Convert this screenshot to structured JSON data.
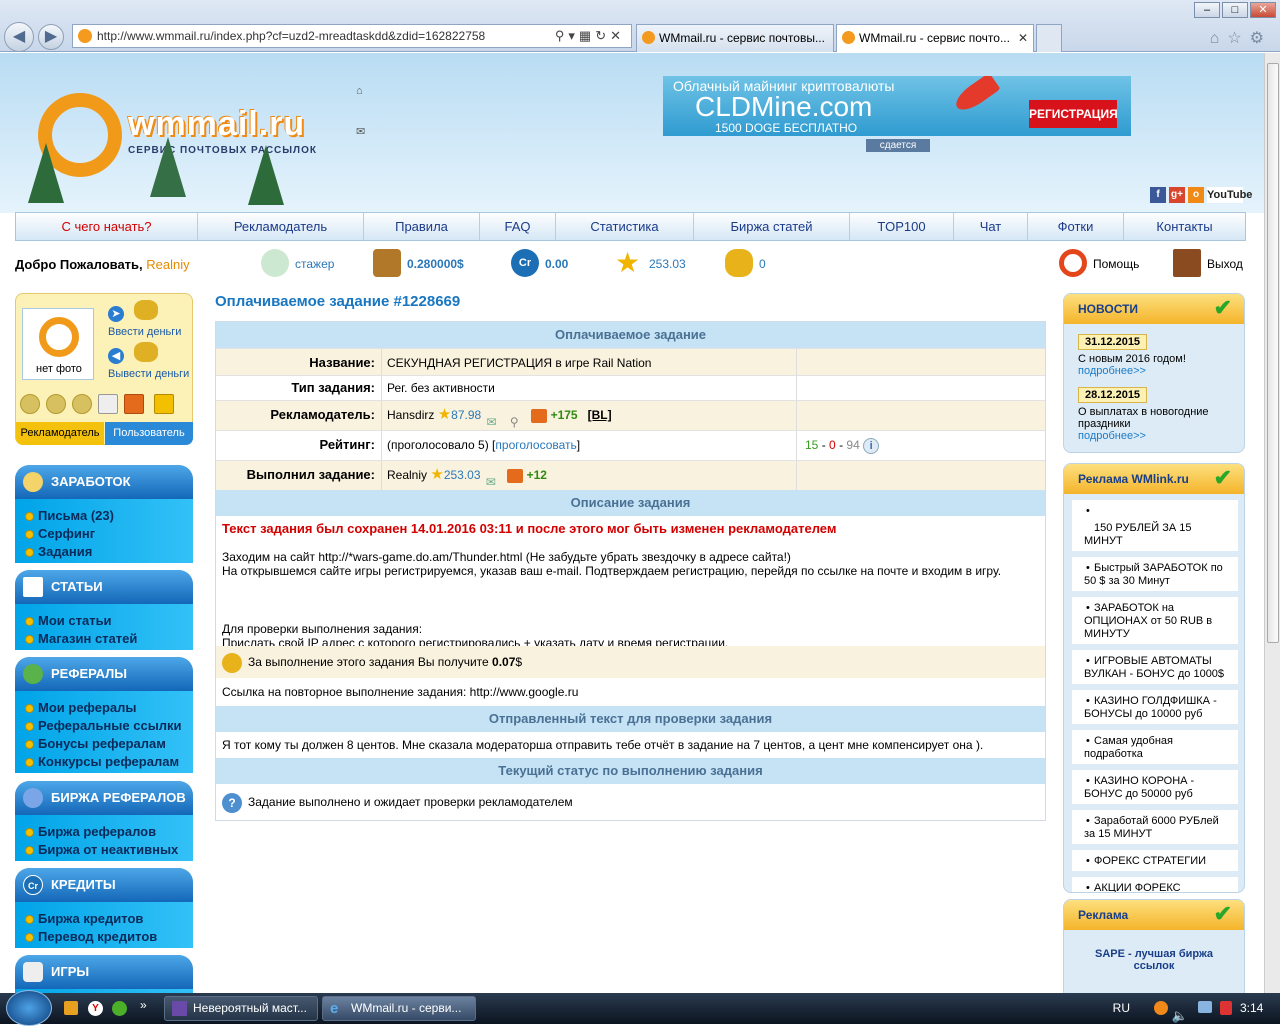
{
  "browser": {
    "url": "http://www.wmmail.ru/index.php?cf=uzd2-mreadtaskdd&zdid=162822758",
    "tabs": [
      {
        "label": "WMmail.ru - сервис почтовы..."
      },
      {
        "label": "WMmail.ru - сервис почто..."
      }
    ]
  },
  "header": {
    "logo_name": "wmmail.ru",
    "logo_sub": "СЕРВИС ПОЧТОВЫХ РАССЫЛОК",
    "banner": {
      "line1": "Облачный майнинг криптовалюты",
      "line2": "CLDMine.com",
      "line3": "1500 DOGE БЕСПЛАТНО",
      "button": "РЕГИСТРАЦИЯ",
      "tag": "сдается"
    },
    "social_youtube": "YouTube"
  },
  "menu": [
    {
      "label": "С чего начать?"
    },
    {
      "label": "Рекламодатель"
    },
    {
      "label": "Правила"
    },
    {
      "label": "FAQ"
    },
    {
      "label": "Статистика"
    },
    {
      "label": "Биржа статей"
    },
    {
      "label": "TOP100"
    },
    {
      "label": "Чат"
    },
    {
      "label": "Фотки"
    },
    {
      "label": "Контакты"
    }
  ],
  "welcome": {
    "greeting": "Добро Пожаловать,",
    "username": "Realniy",
    "status": "стажер",
    "balance": "0.280000$",
    "credits": "0.00",
    "rating": "253.03",
    "coins": "0",
    "help": "Помощь",
    "logout": "Выход"
  },
  "userbox": {
    "no_photo": "нет фото",
    "deposit": "Ввести деньги",
    "withdraw": "Вывести деньги",
    "tab_advertiser": "Рекламодатель",
    "tab_user": "Пользователь"
  },
  "sidebar": {
    "earnings": {
      "title": "ЗАРАБОТОК",
      "items": [
        "Письма (23)",
        "Серфинг",
        "Задания"
      ]
    },
    "articles": {
      "title": "СТАТЬИ",
      "items": [
        "Мои статьи",
        "Магазин статей"
      ]
    },
    "referrals": {
      "title": "РЕФЕРАЛЫ",
      "items": [
        "Мои рефералы",
        "Реферальные ссылки",
        "Бонусы рефералам",
        "Конкурсы рефералам"
      ]
    },
    "ref_exchange": {
      "title": "БИРЖА РЕФЕРАЛОВ",
      "items": [
        "Биржа рефералов",
        "Биржа от неактивных"
      ]
    },
    "credits": {
      "title": "КРЕДИТЫ",
      "items": [
        "Биржа кредитов",
        "Перевод кредитов"
      ]
    },
    "games": {
      "title": "ИГРЫ"
    }
  },
  "task": {
    "page_title": "Оплачиваемое задание #1228669",
    "section_main": "Оплачиваемое задание",
    "name_label": "Название:",
    "name_value": "СЕКУНДНАЯ РЕГИСТРАЦИЯ в игре Rail Nation",
    "type_label": "Тип задания:",
    "type_value": "Рег. без активности",
    "advertiser_label": "Рекламодатель:",
    "advertiser_name": "Hansdirz",
    "advertiser_rating": "87.98",
    "advertiser_bonus": "+175",
    "advertiser_bl": "[BL]",
    "rating_label": "Рейтинг:",
    "rating_votes": "(проголосовало 5) [",
    "rating_vote_link": "проголосовать",
    "rating_close": "]",
    "rating_pos": "15",
    "rating_mid": "0",
    "rating_neg": "94",
    "rating_sep": "-",
    "done_label": "Выполнил задание:",
    "done_user": "Realniy",
    "done_rating": "253.03",
    "done_bonus": "+12",
    "section_desc": "Описание задания",
    "saved_notice": "Текст задания был сохранен 14.01.2016 03:11 и после этого мог быть изменен рекламодателем",
    "desc_line1": "Заходим на сайт http://*wars-game.do.am/Thunder.html (Не забудьте убрать звездочку в адресе сайта!)",
    "desc_line2": "На открывшемся сайте игры регистрируемся, указав ваш e-mail. Подтверждаем регистрацию, перейдя по ссылке на почте и входим в игру.",
    "check_line1": "Для проверки выполнения задания:",
    "check_line2": "Прислать свой IP адрес с которого регистрировались + указать дату и время регистрации.",
    "reward_text": "За выполнение этого задания Вы получите",
    "reward_value": "0.07",
    "reward_unit": "$",
    "repeat_label": "Ссылка на повторное выполнение задания:",
    "repeat_link": "http://www.google.ru",
    "section_sent": "Отправленный текст для проверки задания",
    "sent_text": "Я тот кому ты должен 8 центов. Мне сказала модераторша отправить тебе отчёт в задание на 7 центов, а цент мне компенсирует она ).",
    "section_status": "Текущий статус по выполнению задания",
    "status_text": "Задание выполнено и ожидает проверки рекламодателем"
  },
  "news": {
    "title": "НОВОСТИ",
    "items": [
      {
        "date": "31.12.2015",
        "text": "С новым 2016 годом!",
        "more": "подробнее>>"
      },
      {
        "date": "28.12.2015",
        "text": "О выплатах в новогодние праздники",
        "more": "подробнее>>"
      }
    ]
  },
  "wmlink": {
    "title": "Реклама WMlink.ru",
    "items": [
      "150 РУБЛЕЙ ЗА 15 МИНУТ",
      "Быстрый ЗАРАБОТОК по 50 $ за 30 Минут",
      "ЗАРАБОТОК на ОПЦИОНАХ от 50 RUB в МИНУТУ",
      "ИГРОВЫЕ АВТОМАТЫ ВУЛКАН - БОНУС до 1000$",
      "КАЗИНО ГОЛДФИШКА - БОНУСЫ до 10000 руб",
      "Самая удобная подработка",
      "КАЗИНО КОРОНА - БОНУС до 50000 руб",
      "Заработай 6000 РУБлей за 15 МИНУТ",
      "ФОРЕКС СТРАТЕГИИ",
      "АКЦИИ ФОРЕКС"
    ]
  },
  "ad": {
    "title": "Реклама",
    "link": "SAPE - лучшая биржа ссылок"
  },
  "taskbar": {
    "items": [
      "Невероятный маст...",
      "WMmail.ru - серви..."
    ],
    "lang": "RU",
    "time": "3:14"
  }
}
